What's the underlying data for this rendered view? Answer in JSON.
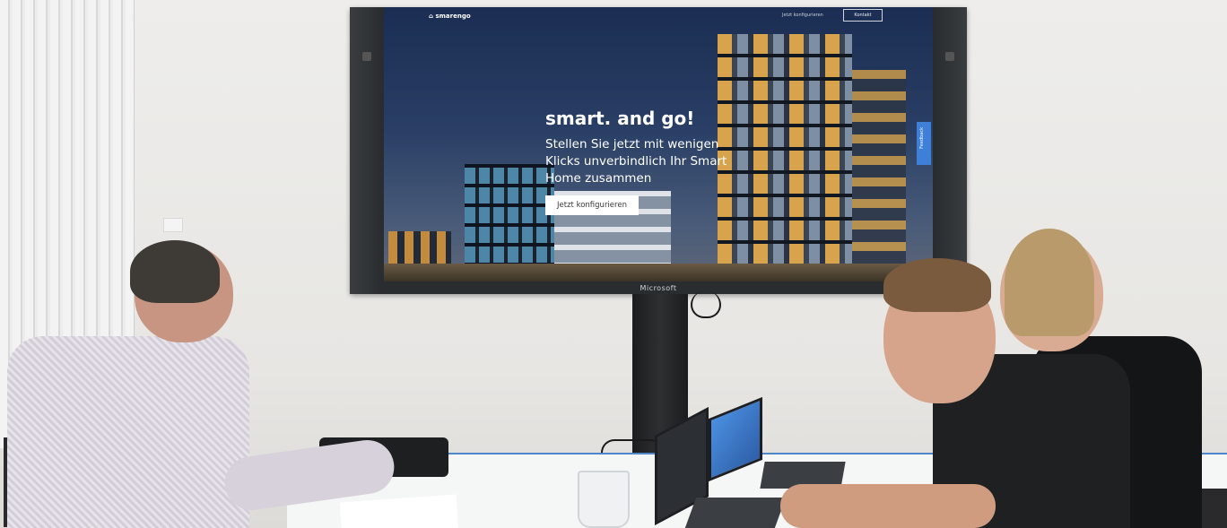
{
  "screen": {
    "nav_logo": "smarengo",
    "nav_link": "Jetzt konfigurieren",
    "nav_button": "Kontakt",
    "hero_title": "smart. and go!",
    "hero_subtitle": "Stellen Sie jetzt mit wenigen Klicks unverbindlich Ihr Smart Home zusammen",
    "cta_label": "Jetzt konfigurieren",
    "feedback_label": "Feedback"
  },
  "display": {
    "brand": "Microsoft"
  },
  "colors": {
    "cta_background": "#ffffff",
    "feedback_tab": "#3e7fd8",
    "table_edge": "#4d86c9"
  }
}
